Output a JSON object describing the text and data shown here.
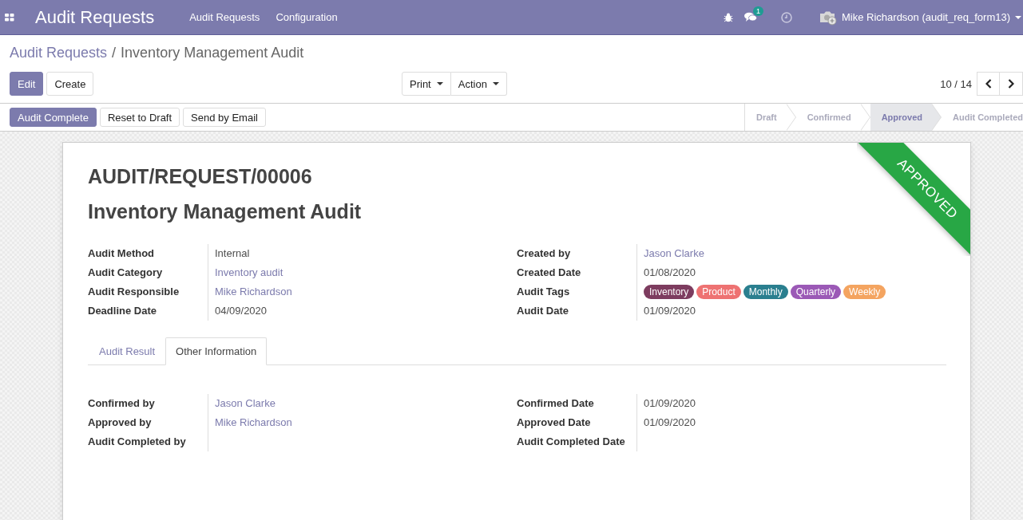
{
  "navbar": {
    "app_title": "Audit Requests",
    "menu": [
      "Audit Requests",
      "Configuration"
    ],
    "messages_count": "1",
    "user": "Mike Richardson (audit_req_form13)"
  },
  "breadcrumb": {
    "parent": "Audit Requests",
    "separator": "/",
    "current": "Inventory Management Audit"
  },
  "buttons": [
    {
      "label": "Edit",
      "primary": true
    },
    {
      "label": "Create",
      "primary": false
    }
  ],
  "dropdowns": [
    "Print",
    "Action"
  ],
  "pager": "10 / 14",
  "status_buttons": [
    {
      "label": "Audit Complete",
      "primary": true
    },
    {
      "label": "Reset to Draft",
      "primary": false
    },
    {
      "label": "Send by Email",
      "primary": false
    }
  ],
  "stages": [
    {
      "label": "Draft",
      "selected": false
    },
    {
      "label": "Confirmed",
      "selected": false
    },
    {
      "label": "Approved",
      "selected": true
    },
    {
      "label": "Audit Completed",
      "selected": false
    }
  ],
  "ribbon": "APPROVED",
  "reference": "AUDIT/REQUEST/00006",
  "title": "Inventory Management Audit",
  "fields_left": [
    {
      "label": "Audit Method",
      "kind": "text",
      "value": "Internal"
    },
    {
      "label": "Audit Category",
      "kind": "link",
      "value": "Inventory audit"
    },
    {
      "label": "Audit Responsible",
      "kind": "link",
      "value": "Mike Richardson"
    },
    {
      "label": "Deadline Date",
      "kind": "text",
      "value": "04/09/2020"
    }
  ],
  "fields_right": [
    {
      "label": "Created by",
      "kind": "link",
      "value": "Jason Clarke"
    },
    {
      "label": "Created Date",
      "kind": "text",
      "value": "01/08/2020"
    },
    {
      "label": "Audit Tags",
      "kind": "tags",
      "tags": [
        {
          "label": "Inventory",
          "color": "#7d3c5f"
        },
        {
          "label": "Product",
          "color": "#ee7272"
        },
        {
          "label": "Monthly",
          "color": "#2a7f8f"
        },
        {
          "label": "Quarterly",
          "color": "#9b59b6"
        },
        {
          "label": "Weekly",
          "color": "#f4a460"
        }
      ]
    },
    {
      "label": "Audit Date",
      "kind": "text",
      "value": "01/09/2020"
    }
  ],
  "tabs": [
    {
      "label": "Audit Result",
      "selected": false
    },
    {
      "label": "Other Information",
      "selected": true
    }
  ],
  "tab_left": [
    {
      "label": "Confirmed by",
      "kind": "link",
      "value": "Jason Clarke"
    },
    {
      "label": "Approved by",
      "kind": "link",
      "value": "Mike Richardson"
    },
    {
      "label": "Audit Completed by",
      "kind": "empty"
    }
  ],
  "tab_right": [
    {
      "label": "Confirmed Date",
      "kind": "text",
      "value": "01/09/2020"
    },
    {
      "label": "Approved Date",
      "kind": "text",
      "value": "01/09/2020"
    },
    {
      "label": "Audit Completed Date",
      "kind": "empty"
    }
  ]
}
